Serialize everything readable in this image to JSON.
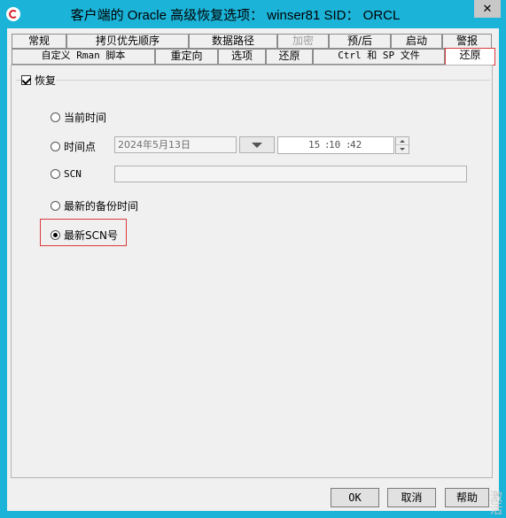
{
  "window": {
    "title": "客户端的 Oracle 高级恢复选项： winser81  SID： ORCL",
    "close": "✕"
  },
  "tabs_row1": [
    {
      "label": "常规"
    },
    {
      "label": "拷贝优先顺序"
    },
    {
      "label": "数据路径"
    },
    {
      "label": "加密"
    },
    {
      "label": "预/后"
    },
    {
      "label": "启动"
    },
    {
      "label": "警报"
    }
  ],
  "tabs_row2": [
    {
      "label": "自定义 Rman 脚本"
    },
    {
      "label": "重定向"
    },
    {
      "label": "选项"
    },
    {
      "label": "还原"
    },
    {
      "label": "Ctrl 和 SP 文件"
    },
    {
      "label": "还原"
    }
  ],
  "recover": {
    "checkbox_label": "恢复",
    "checked": true
  },
  "options": {
    "current_time": "当前时间",
    "point_in_time": "时间点",
    "date_value": "2024年5月13日",
    "hour": "15",
    "minute": "10",
    "second": "42",
    "scn": "SCN",
    "scn_value": "",
    "latest_backup_time": "最新的备份时间",
    "latest_scn": "最新SCN号",
    "selected": "latest_scn"
  },
  "buttons": {
    "ok": "OK",
    "cancel": "取消",
    "help": "帮助"
  },
  "watermark": "激活"
}
